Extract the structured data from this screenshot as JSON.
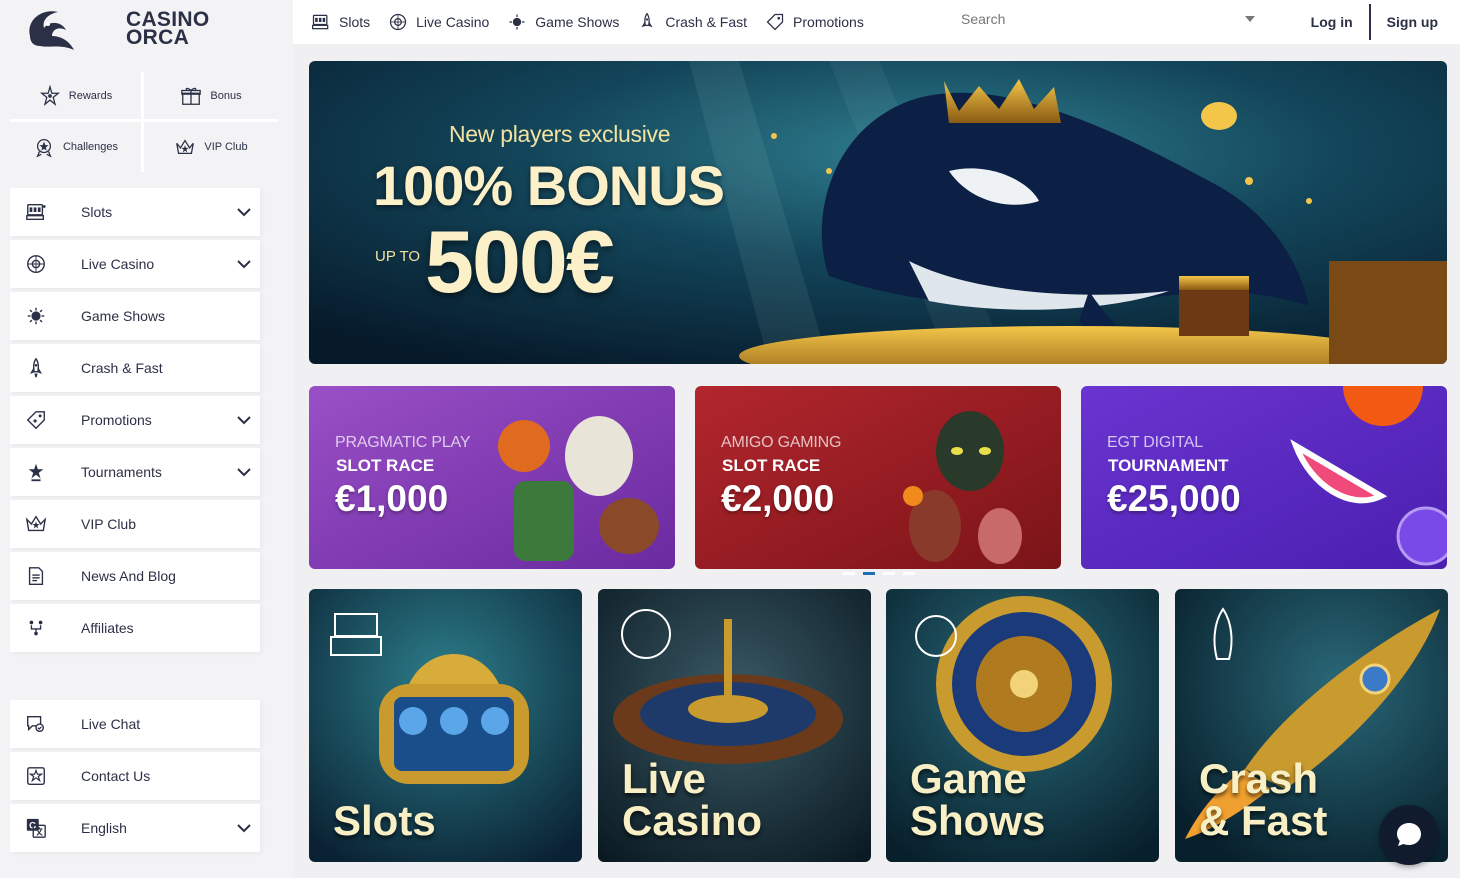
{
  "brand": {
    "line1": "CASINO",
    "line2": "ORCA"
  },
  "quick_links": [
    {
      "label": "Rewards",
      "icon": "rewards-icon"
    },
    {
      "label": "Bonus",
      "icon": "gift-icon"
    },
    {
      "label": "Challenges",
      "icon": "challenges-icon"
    },
    {
      "label": "VIP Club",
      "icon": "crown-icon"
    }
  ],
  "sidebar_menu": [
    {
      "label": "Slots",
      "icon": "slot-machine-icon",
      "has_dropdown": true
    },
    {
      "label": "Live Casino",
      "icon": "roulette-icon",
      "has_dropdown": true
    },
    {
      "label": "Game Shows",
      "icon": "game-shows-icon",
      "has_dropdown": false
    },
    {
      "label": "Crash & Fast",
      "icon": "rocket-icon",
      "has_dropdown": false
    },
    {
      "label": "Promotions",
      "icon": "promotions-icon",
      "has_dropdown": true
    },
    {
      "label": "Tournaments",
      "icon": "trophy-icon",
      "has_dropdown": true
    },
    {
      "label": "VIP Club",
      "icon": "crown-icon",
      "has_dropdown": false
    },
    {
      "label": "News And Blog",
      "icon": "news-icon",
      "has_dropdown": false
    },
    {
      "label": "Affiliates",
      "icon": "affiliates-icon",
      "has_dropdown": false
    }
  ],
  "sidebar_bottom": [
    {
      "label": "Live Chat",
      "icon": "live-chat-icon",
      "has_dropdown": false
    },
    {
      "label": "Contact Us",
      "icon": "contact-icon",
      "has_dropdown": false
    },
    {
      "label": "English",
      "icon": "translate-icon",
      "has_dropdown": true
    }
  ],
  "top_nav": [
    {
      "label": "Slots",
      "icon": "slot-machine-icon"
    },
    {
      "label": "Live Casino",
      "icon": "roulette-icon"
    },
    {
      "label": "Game Shows",
      "icon": "game-shows-icon"
    },
    {
      "label": "Crash & Fast",
      "icon": "rocket-icon"
    },
    {
      "label": "Promotions",
      "icon": "promotions-icon"
    }
  ],
  "search": {
    "placeholder": "Search"
  },
  "auth": {
    "login": "Log in",
    "signup": "Sign up"
  },
  "hero": {
    "tagline": "New players exclusive",
    "headline": "100% BONUS",
    "upto": "UP TO",
    "amount": "500€"
  },
  "promos": [
    {
      "provider": "PRAGMATIC PLAY",
      "type": "SLOT RACE",
      "amount": "€1,000",
      "color": "#8a3fb8"
    },
    {
      "provider": "AMIGO GAMING",
      "type": "SLOT RACE",
      "amount": "€2,000",
      "color": "#a8242b"
    },
    {
      "provider": "EGT DIGITAL",
      "type": "TOURNAMENT",
      "amount": "€25,000",
      "color": "#5a2fc4"
    }
  ],
  "carousel": {
    "slides": 4,
    "active": 1
  },
  "categories": [
    {
      "label": "Slots"
    },
    {
      "label": "Live\nCasino"
    },
    {
      "label": "Game\nShows"
    },
    {
      "label": "Crash\n& Fast"
    }
  ],
  "colors": {
    "sidebar_bg": "#f3f3f5",
    "text_dark": "#2b3046",
    "accent_gold": "#f3e2a2",
    "active_dot": "#1f6fb2",
    "chat_bg": "#101b2e"
  }
}
